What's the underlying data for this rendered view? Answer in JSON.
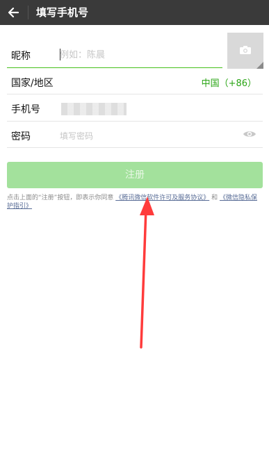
{
  "header": {
    "title": "填写手机号",
    "back_icon": "arrow-left-icon"
  },
  "form": {
    "nickname": {
      "label": "昵称",
      "placeholder": "例如：陈晨"
    },
    "country": {
      "label": "国家/地区",
      "value": "中国（+86）"
    },
    "phone": {
      "label": "手机号"
    },
    "password": {
      "label": "密码",
      "placeholder": "填写密码"
    }
  },
  "register_button": {
    "label": "注册"
  },
  "agreement": {
    "prefix": "点击上面的“注册”按钮，即表示你同意",
    "link1": "《腾讯微信软件许可及服务协议》",
    "middle": "和",
    "link2": "《微信隐私保护指引》"
  },
  "colors": {
    "accent_green": "#45c01a",
    "country_green": "#2aa515",
    "button_disabled": "#a3e19c",
    "link_blue": "#576b95",
    "annotation_red": "#ff3b3b"
  }
}
